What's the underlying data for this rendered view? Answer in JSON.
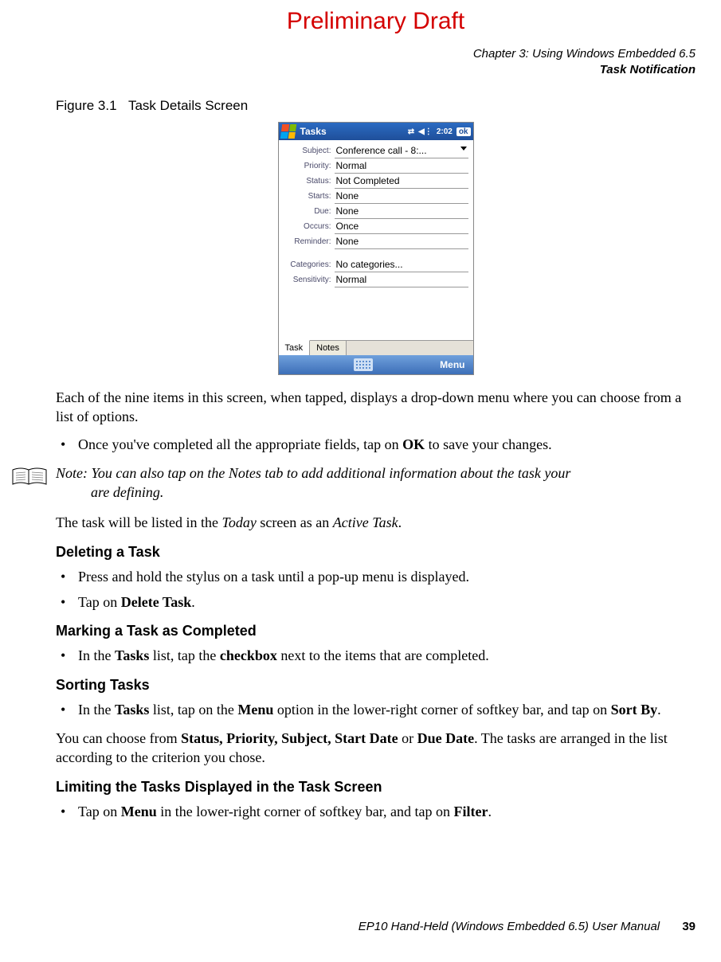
{
  "draft_banner": "Preliminary Draft",
  "header": {
    "chapter": "Chapter 3:  Using Windows Embedded 6.5",
    "section": "Task Notification"
  },
  "figure": {
    "number": "Figure 3.1",
    "title": "Task Details Screen"
  },
  "device": {
    "title": "Tasks",
    "time": "2:02",
    "ok": "ok",
    "rows": [
      {
        "label": "Subject:",
        "value": "Conference call - 8:...",
        "dropdown": true
      },
      {
        "label": "Priority:",
        "value": "Normal"
      },
      {
        "label": "Status:",
        "value": "Not Completed"
      },
      {
        "label": "Starts:",
        "value": "None"
      },
      {
        "label": "Due:",
        "value": "None"
      },
      {
        "label": "Occurs:",
        "value": "Once"
      },
      {
        "label": "Reminder:",
        "value": "None"
      }
    ],
    "rows2": [
      {
        "label": "Categories:",
        "value": "No categories..."
      },
      {
        "label": "Sensitivity:",
        "value": "Normal"
      }
    ],
    "tabs": {
      "task": "Task",
      "notes": "Notes"
    },
    "menu": "Menu"
  },
  "para_after_fig": "Each of the nine items in this screen, when tapped, displays a drop-down menu where you can choose from a list of options.",
  "bullet_ok_pre": "Once you've completed all the appropriate fields, tap on ",
  "bullet_ok_bold": "OK",
  "bullet_ok_post": " to save your changes.",
  "note": {
    "label": "Note:",
    "line1_rest": " You can also tap on the Notes tab to add additional information about the task your",
    "line2": "are defining."
  },
  "para_today_pre": "The task will be listed in the ",
  "para_today_i1": "Today",
  "para_today_mid": " screen as an ",
  "para_today_i2": "Active Task",
  "para_today_post": ".",
  "h_delete": "Deleting a Task",
  "del_b1": "Press and hold the stylus on a task until a pop-up menu is displayed.",
  "del_b2_pre": "Tap on ",
  "del_b2_bold": "Delete Task",
  "del_b2_post": ".",
  "h_mark": "Marking a Task as Completed",
  "mark_b1_pre": "In the ",
  "mark_b1_b1": "Tasks",
  "mark_b1_mid": " list, tap the ",
  "mark_b1_b2": "checkbox",
  "mark_b1_post": " next to the items that are completed.",
  "h_sort": "Sorting Tasks",
  "sort_b1_pre": "In the ",
  "sort_b1_b1": "Tasks",
  "sort_b1_mid": " list, tap on the ",
  "sort_b1_b2": "Menu",
  "sort_b1_mid2": " option in the lower-right corner of softkey bar, and tap on ",
  "sort_b1_b3": "Sort By",
  "sort_b1_post": ".",
  "sort_p_pre": "You can choose from ",
  "sort_p_b1": "Status, Priority, Subject, Start Date",
  "sort_p_mid": " or ",
  "sort_p_b2": "Due Date",
  "sort_p_post": ". The tasks are arranged in the list according to the criterion you chose.",
  "h_limit": "Limiting the Tasks Displayed in the Task Screen",
  "limit_b1_pre": "Tap on ",
  "limit_b1_b1": "Menu",
  "limit_b1_mid": " in the lower-right corner of softkey bar, and tap on ",
  "limit_b1_b2": "Filter",
  "limit_b1_post": ".",
  "footer": {
    "manual": "EP10 Hand-Held (Windows Embedded 6.5) User Manual",
    "page": "39"
  }
}
